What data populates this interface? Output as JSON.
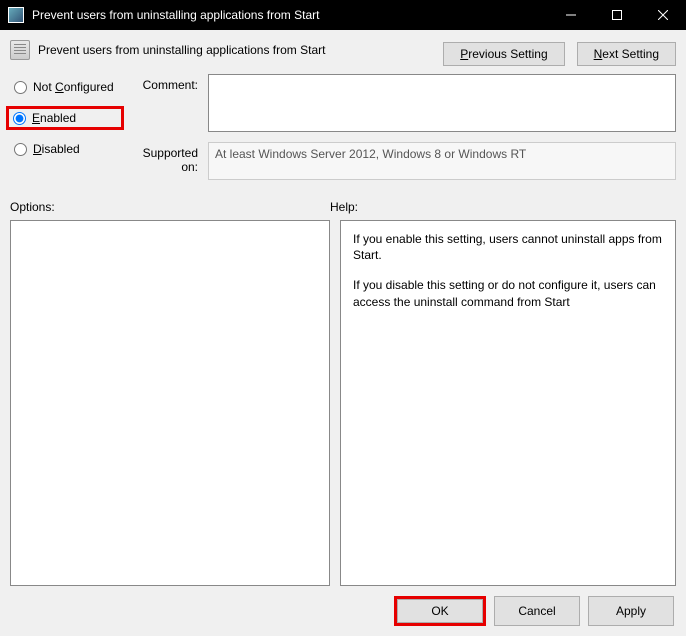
{
  "window": {
    "title": "Prevent users from uninstalling applications from Start"
  },
  "policy": {
    "name": "Prevent users from uninstalling applications from Start",
    "nav_prev": "Previous Setting",
    "nav_next": "Next Setting"
  },
  "state": {
    "not_configured": "Not Configured",
    "enabled": "Enabled",
    "disabled": "Disabled",
    "selected": "enabled"
  },
  "fields": {
    "comment_label": "Comment:",
    "comment_value": "",
    "supported_label": "Supported on:",
    "supported_value": "At least Windows Server 2012, Windows 8 or Windows RT"
  },
  "sections": {
    "options": "Options:",
    "help": "Help:"
  },
  "help_text": {
    "p1": "If you enable this setting, users cannot uninstall apps from Start.",
    "p2": "If you disable this setting or do not configure it, users can access the uninstall command from Start"
  },
  "buttons": {
    "ok": "OK",
    "cancel": "Cancel",
    "apply": "Apply"
  }
}
